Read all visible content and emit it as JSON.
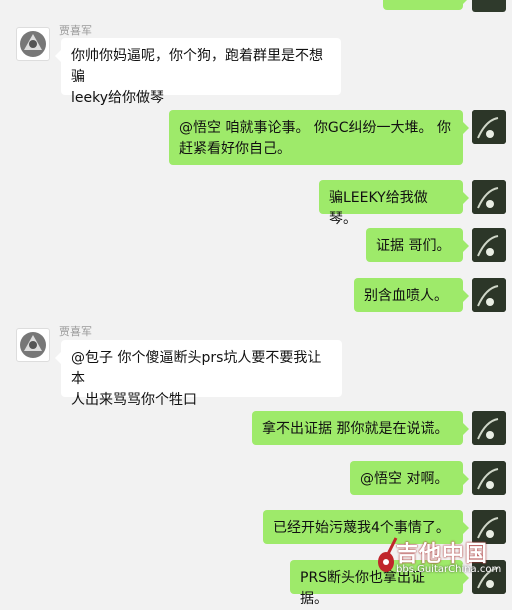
{
  "sender_left_name": "贾喜军",
  "messages": [
    {
      "side": "left",
      "name": "贾喜军",
      "text": "你帅你妈逼呢，你个狗，跑着群里是不想骗\nleeky给你做琴"
    },
    {
      "side": "right",
      "text": "@悟空  咱就事论事。 你GC纠纷一大堆。 你\n赶紧看好你自己。"
    },
    {
      "side": "right",
      "text": "骗LEEKY给我做琴。"
    },
    {
      "side": "right",
      "text": "证据 哥们。"
    },
    {
      "side": "right",
      "text": "别含血喷人。"
    },
    {
      "side": "left",
      "name": "贾喜军",
      "text": "@包子 你个傻逼断头prs坑人要不要我让本\n人出来骂骂你个牲口"
    },
    {
      "side": "right",
      "text": "拿不出证据 那你就是在说谎。"
    },
    {
      "side": "right",
      "text": "@悟空  对啊。"
    },
    {
      "side": "right",
      "text": "已经开始污蔑我4个事情了。"
    },
    {
      "side": "right",
      "text": "PRS断头你也拿出证据。"
    }
  ],
  "watermark": {
    "main": "吉他中国",
    "sub": "bbs.GuitarChina.com"
  },
  "colors": {
    "right_bubble": "#9eea6a",
    "left_bubble": "#ffffff",
    "background": "#f2f2f2"
  }
}
